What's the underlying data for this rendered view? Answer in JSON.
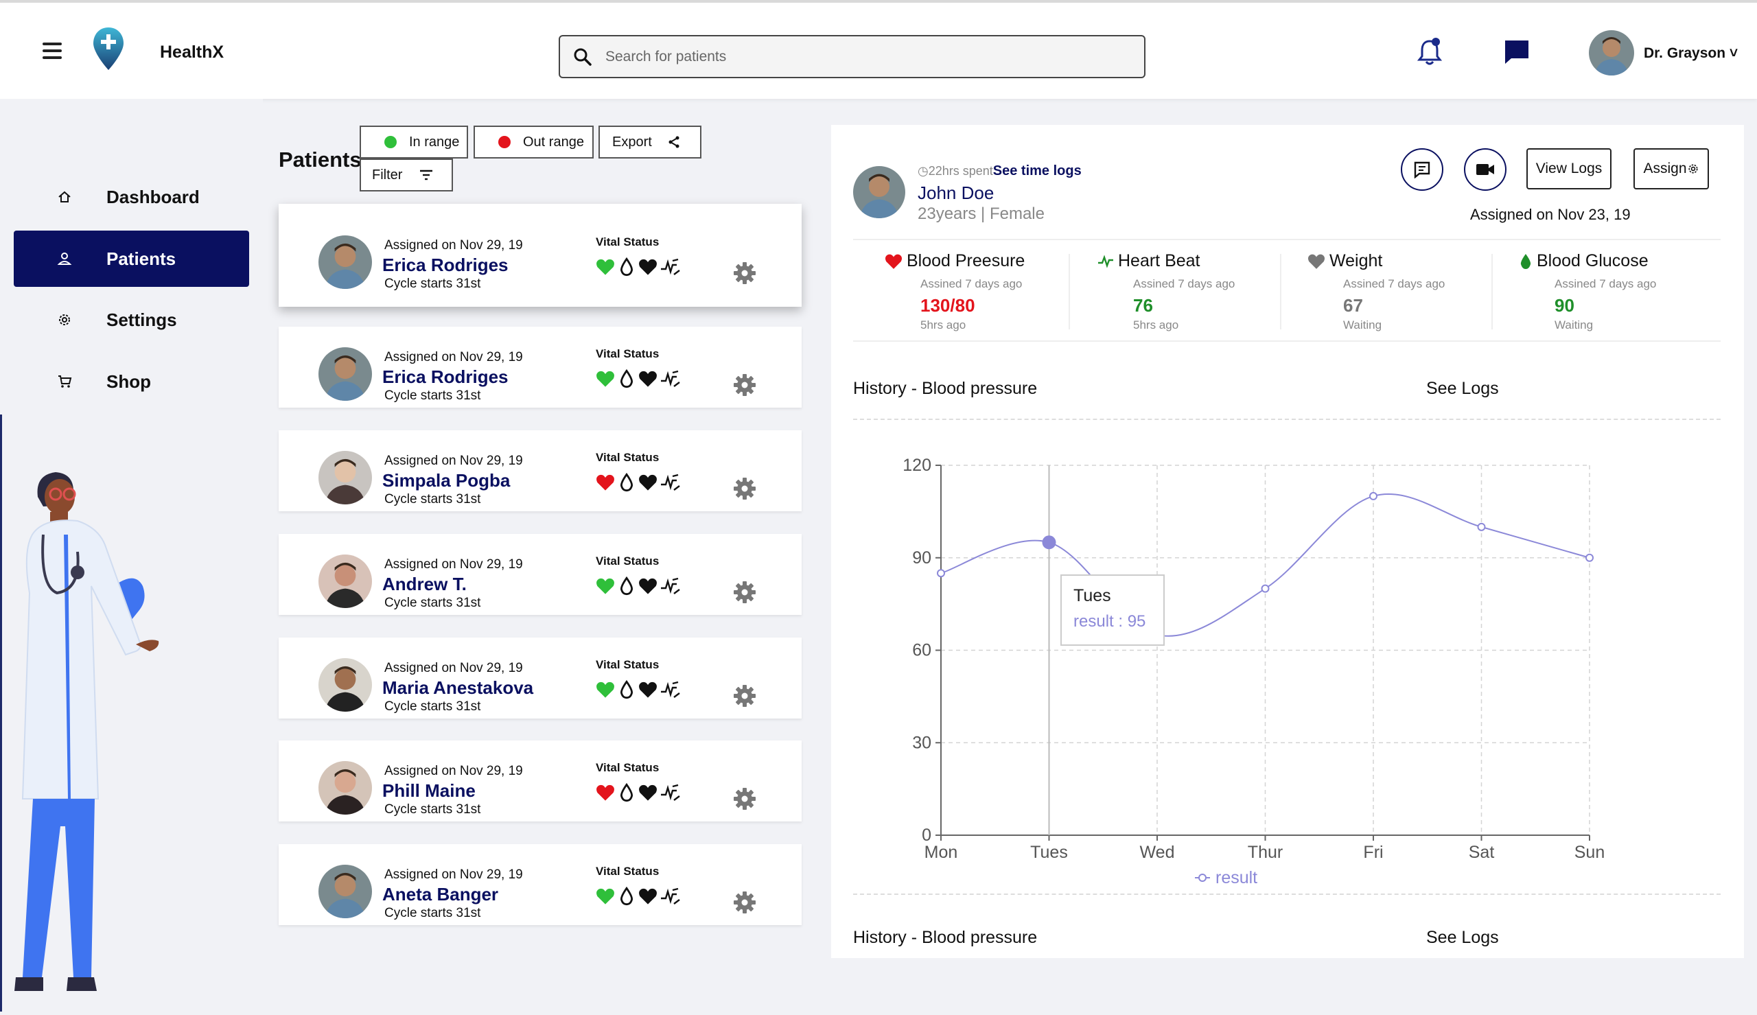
{
  "app": {
    "title": "HealthX"
  },
  "search": {
    "placeholder": "Search for patients"
  },
  "user": {
    "name": "Dr. Grayson ˅"
  },
  "nav": {
    "items": [
      {
        "label": "Dashboard",
        "icon": "home-icon"
      },
      {
        "label": "Patients",
        "icon": "person-icon",
        "active": true
      },
      {
        "label": "Settings",
        "icon": "gear-icon"
      },
      {
        "label": "Shop",
        "icon": "cart-icon"
      }
    ]
  },
  "patients": {
    "title": "Patients",
    "filters": {
      "in_range": "In range",
      "out_range": "Out range",
      "export": "Export",
      "filter": "Filter"
    },
    "vital_label": "Vital Status",
    "list": [
      {
        "assigned": "Assigned on Nov 29, 19",
        "name": "Erica Rodriges",
        "cycle": "Cycle starts 31st",
        "status": "in"
      },
      {
        "assigned": "Assigned on Nov 29, 19",
        "name": "Erica Rodriges",
        "cycle": "Cycle starts 31st",
        "status": "in"
      },
      {
        "assigned": "Assigned on Nov 29, 19",
        "name": "Simpala Pogba",
        "cycle": "Cycle starts 31st",
        "status": "out"
      },
      {
        "assigned": "Assigned on Nov 29, 19",
        "name": "Andrew T.",
        "cycle": "Cycle starts 31st",
        "status": "in"
      },
      {
        "assigned": "Assigned on Nov 29, 19",
        "name": "Maria Anestakova",
        "cycle": "Cycle starts 31st",
        "status": "in"
      },
      {
        "assigned": "Assigned on Nov 29, 19",
        "name": "Phill Maine",
        "cycle": "Cycle starts 31st",
        "status": "out"
      },
      {
        "assigned": "Assigned on Nov 29, 19",
        "name": "Aneta Banger",
        "cycle": "Cycle starts 31st",
        "status": "in"
      }
    ]
  },
  "detail": {
    "time_spent": "22hrs spent",
    "see_time_logs": "See time logs",
    "name": "John Doe",
    "sub": "23years | Female",
    "view_logs": "View Logs",
    "assign": "Assign",
    "assigned_on": "Assigned on Nov 23, 19",
    "vitals": [
      {
        "title": "Blood Preesure",
        "assigned": "Assined 7 days ago",
        "value": "130/80",
        "sub": "5hrs ago",
        "color": "#e3141c",
        "icon": "heart-icon"
      },
      {
        "title": "Heart Beat",
        "assigned": "Assined 7 days ago",
        "value": "76",
        "sub": "5hrs ago",
        "color": "#1f8f2a",
        "icon": "pulse-icon"
      },
      {
        "title": "Weight",
        "assigned": "Assined 7 days ago",
        "value": "67",
        "sub": "Waiting",
        "color": "#777777",
        "icon": "heart-icon"
      },
      {
        "title": "Blood Glucose",
        "assigned": "Assined 7 days ago",
        "value": "90",
        "sub": "Waiting",
        "color": "#1f8f2a",
        "icon": "drop-icon"
      }
    ],
    "history": [
      {
        "title": "History - Blood pressure",
        "logs": "See Logs"
      },
      {
        "title": "History - Blood pressure",
        "logs": "See Logs"
      }
    ]
  },
  "chart_data": {
    "type": "line",
    "categories": [
      "Mon",
      "Tues",
      "Wed",
      "Thur",
      "Fri",
      "Sat",
      "Sun"
    ],
    "series": [
      {
        "name": "result",
        "values": [
          85,
          95,
          65,
          80,
          110,
          100,
          90
        ]
      }
    ],
    "ylim": [
      0,
      120
    ],
    "yticks": [
      "0",
      "30",
      "60",
      "90",
      "120"
    ],
    "grid": true,
    "legend": "bottom",
    "color": "#8b88d8",
    "tooltip": {
      "category": "Tues",
      "label": "result : 95"
    }
  }
}
